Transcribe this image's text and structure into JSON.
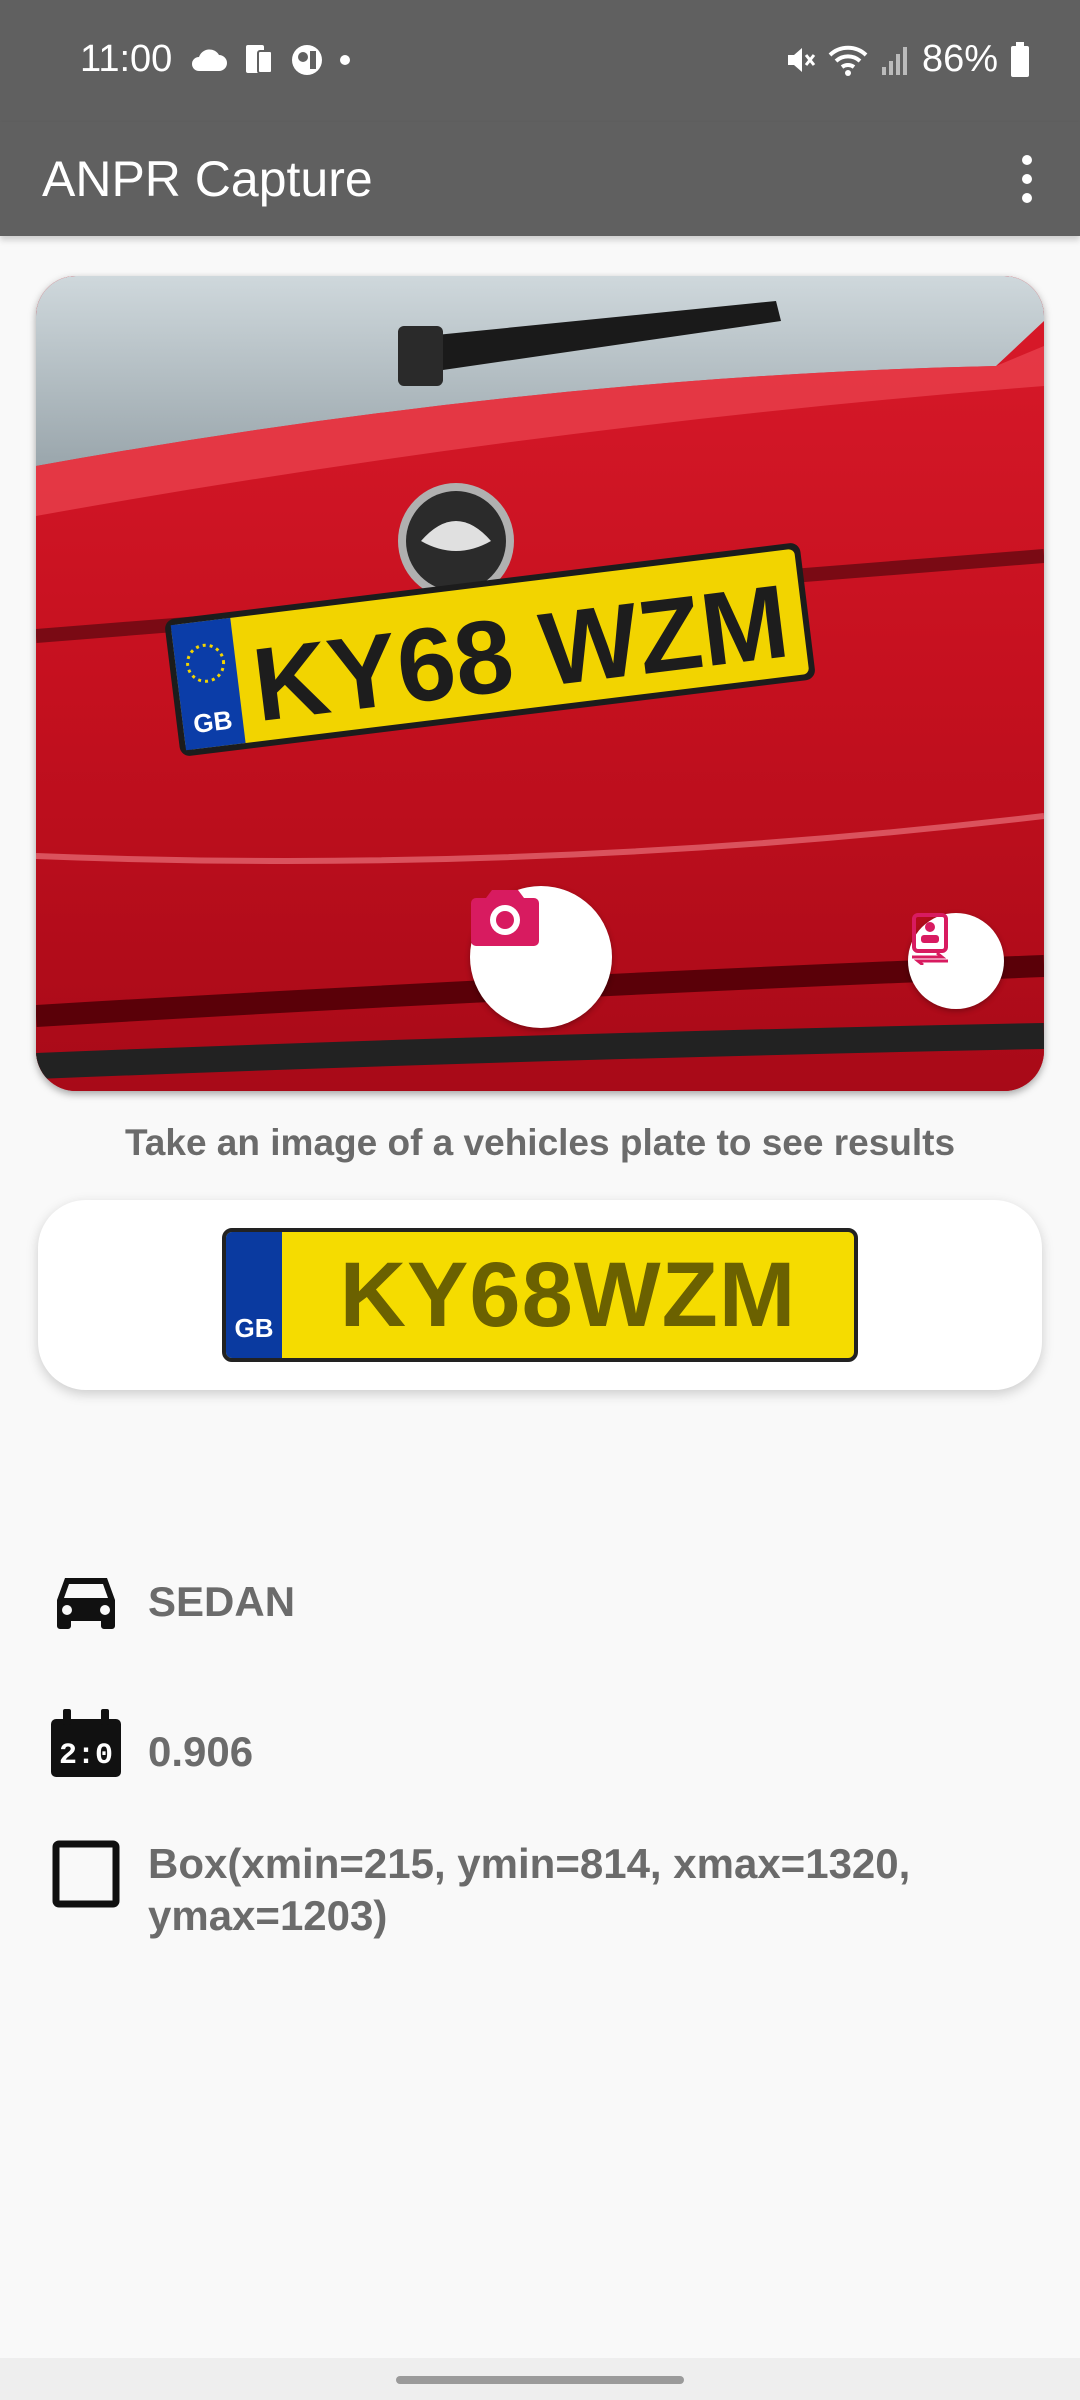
{
  "status_bar": {
    "time": "11:00",
    "battery": "86%"
  },
  "app_bar": {
    "title": "ANPR Capture",
    "menu_icon": "more-vert-icon"
  },
  "preview": {
    "plate_in_image": "KY68 WZM",
    "capture_icon": "camera-icon",
    "switch_icon": "switch-camera-icon"
  },
  "hint": "Take an image of a vehicles plate to see results",
  "result": {
    "country": "GB",
    "plate": "KY68WZM",
    "colors": {
      "plate": "#f5dc00",
      "band": "#0a3aa0",
      "text": "#6b6100"
    }
  },
  "details": {
    "vehicle_type": "SEDAN",
    "score": "0.906",
    "box": "Box(xmin=215, ymin=814, xmax=1320, ymax=1203)"
  },
  "colors": {
    "bar": "#606060",
    "accent": "#d81b60",
    "background": "#f9f9f9"
  }
}
